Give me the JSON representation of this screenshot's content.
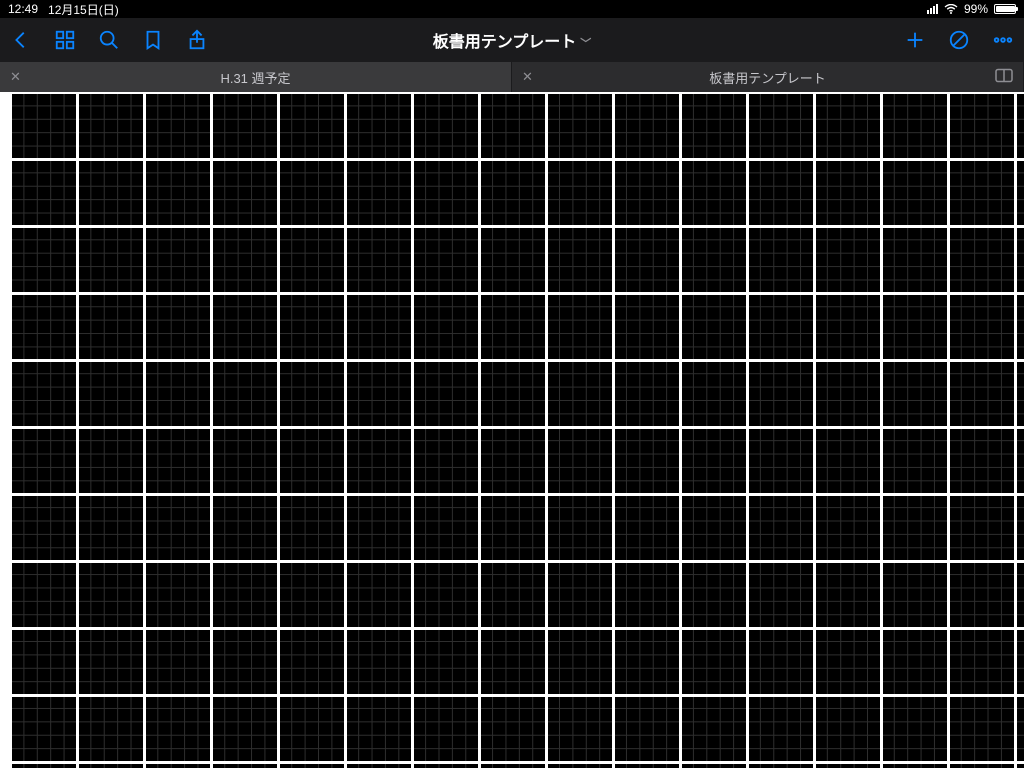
{
  "status": {
    "time": "12:49",
    "date": "12月15日(日)",
    "battery_percent": "99%"
  },
  "toolbar": {
    "title": "板書用テンプレート"
  },
  "tabs": [
    {
      "label": "H.31 週予定",
      "active": true,
      "closable": true
    },
    {
      "label": "板書用テンプレート",
      "active": false,
      "closable": true
    }
  ],
  "document": {
    "background": "#000000",
    "fine_grid_color": "#2e2e2e",
    "major_grid_color": "#ffffff",
    "fine_grid_spacing_px": 13.4,
    "major_grid_every_n_fine": 5
  }
}
